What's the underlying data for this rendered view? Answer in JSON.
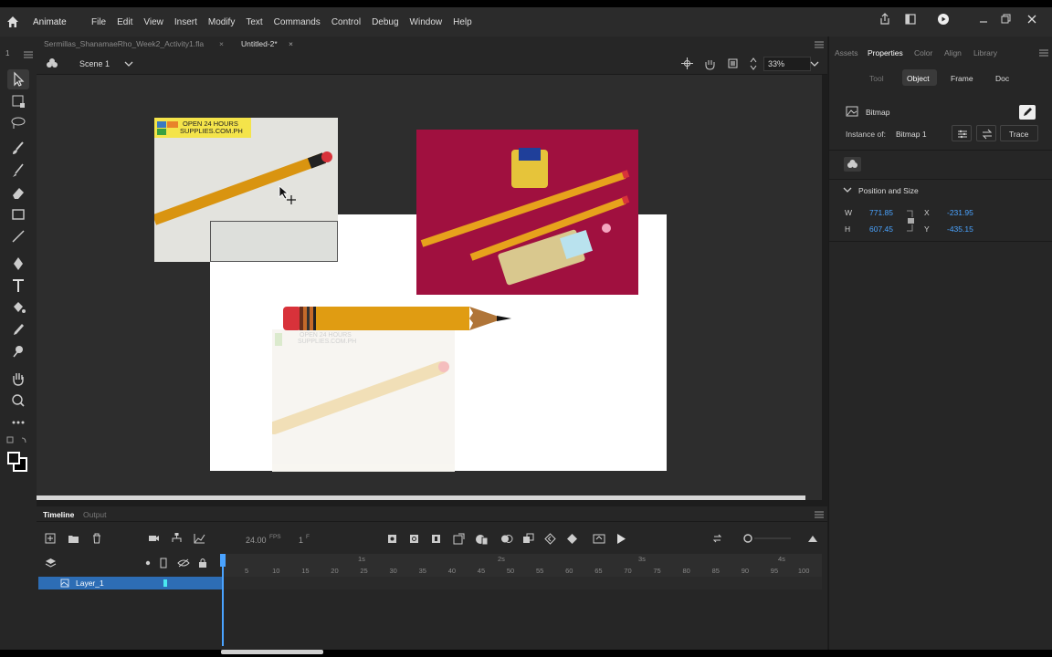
{
  "app": {
    "name": "Animate",
    "menus": [
      "File",
      "Edit",
      "View",
      "Insert",
      "Modify",
      "Text",
      "Commands",
      "Control",
      "Debug",
      "Window",
      "Help"
    ]
  },
  "toolbar_labels": {
    "number_1": "1"
  },
  "tabs": [
    {
      "label": "Sermillas_ShanamaeRho_Week2_Activity1.fla",
      "close": "×"
    },
    {
      "label": "Untitled-2*",
      "close": "×"
    }
  ],
  "scene": {
    "label": "Scene 1",
    "zoom": "33%"
  },
  "stage_images": {
    "left_sign_line1": "OPEN 24 HOURS",
    "left_sign_line2": "SUPPLIES.COM.PH",
    "faded_sign_line1": "OPEN 24 HOURS",
    "faded_sign_line2": "SUPPLIES.COM.PH"
  },
  "properties": {
    "top_tabs": [
      "Assets",
      "Properties",
      "Color",
      "Align",
      "Library"
    ],
    "sub_tabs": [
      "Tool",
      "Object",
      "Frame",
      "Doc"
    ],
    "symbol_type": "Bitmap",
    "instance_label": "Instance of:",
    "instance_value": "Bitmap 1",
    "trace_button": "Trace",
    "section_title": "Position and Size",
    "w_label": "W",
    "w_value": "771.85",
    "h_label": "H",
    "h_value": "607.45",
    "x_label": "X",
    "x_value": "-231.95",
    "y_label": "Y",
    "y_value": "-435.15"
  },
  "timeline": {
    "tabs": [
      "Timeline",
      "Output"
    ],
    "fps": "24.00",
    "fps_unit": "FPS",
    "frame": "1",
    "frame_unit": "F",
    "layer_name": "Layer_1",
    "seconds": [
      "1s",
      "2s",
      "3s",
      "4s"
    ],
    "frame_numbers": [
      "5",
      "10",
      "15",
      "20",
      "25",
      "30",
      "35",
      "40",
      "45",
      "50",
      "55",
      "60",
      "65",
      "70",
      "75",
      "80",
      "85",
      "90",
      "95",
      "100"
    ]
  },
  "colors": {
    "accent_blue": "#1473e6",
    "layer_highlight": "#2d6db5",
    "playhead": "#4aa3ff",
    "magenta_bg": "#a0103f",
    "pencil_yellow": "#e09c12"
  }
}
